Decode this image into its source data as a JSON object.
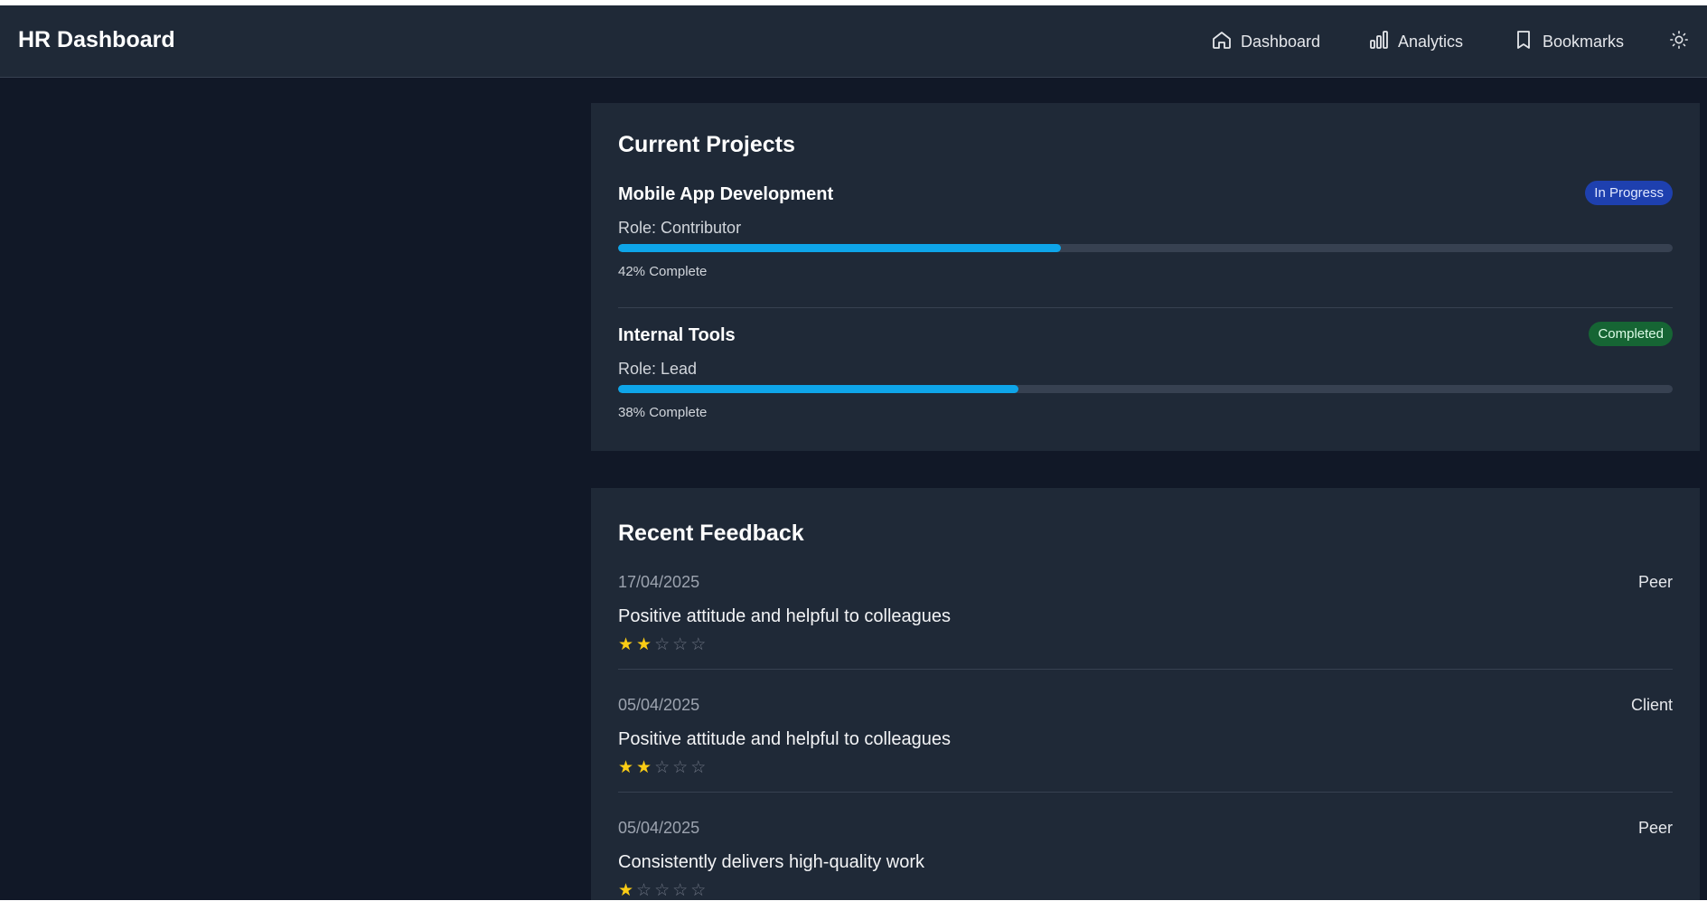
{
  "app": {
    "title": "HR Dashboard"
  },
  "nav": {
    "items": [
      {
        "label": "Dashboard",
        "icon": "home-icon"
      },
      {
        "label": "Analytics",
        "icon": "bar-chart-icon"
      },
      {
        "label": "Bookmarks",
        "icon": "bookmark-icon"
      }
    ],
    "theme_toggle_icon": "sun-icon"
  },
  "projects": {
    "title": "Current Projects",
    "items": [
      {
        "name": "Mobile App Development",
        "status": "In Progress",
        "role": "Role: Contributor",
        "progress_text": "42% Complete",
        "progress": 42
      },
      {
        "name": "Internal Tools",
        "status": "Completed",
        "role": "Role: Lead",
        "progress_text": "38% Complete",
        "progress": 38
      }
    ]
  },
  "feedback": {
    "title": "Recent Feedback",
    "items": [
      {
        "date": "17/04/2025",
        "source": "Peer",
        "text": "Positive attitude and helpful to colleagues",
        "rating": 2,
        "max_rating": 5
      },
      {
        "date": "05/04/2025",
        "source": "Client",
        "text": "Positive attitude and helpful to colleagues",
        "rating": 2,
        "max_rating": 5
      },
      {
        "date": "05/04/2025",
        "source": "Peer",
        "text": "Consistently delivers high-quality work",
        "rating": 1,
        "max_rating": 5
      }
    ]
  },
  "colors": {
    "background": "#111827",
    "surface": "#1f2937",
    "accent": "#0ea5e9",
    "badge_in_progress": "#1e40af",
    "badge_completed": "#166534",
    "star": "#facc15"
  }
}
